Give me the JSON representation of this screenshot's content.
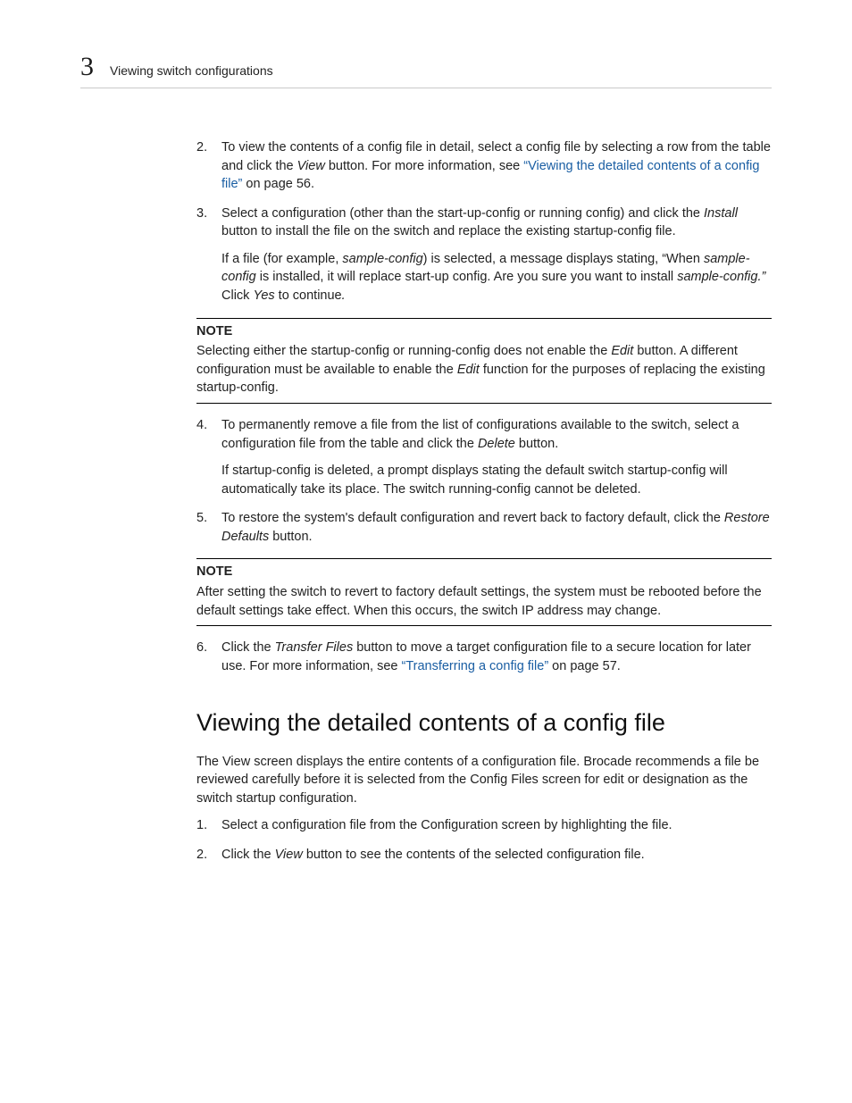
{
  "header": {
    "chapter_number": "3",
    "chapter_title": "Viewing switch configurations"
  },
  "steps_a": [
    {
      "n": "2.",
      "pre": "To view the contents of a config file in detail, select a config file by selecting a row from the table and click the ",
      "i1": "View",
      "mid": " button. For more information, see ",
      "link": "“Viewing the detailed contents of a config file”",
      "post": " on page 56."
    },
    {
      "n": "3.",
      "line1_pre": "Select a configuration (other than the start-up-config or running config) and click the ",
      "line1_i": "Install",
      "line1_post": " button to install the file on the switch and replace the existing startup-config file.",
      "p2_a": "If a file (for example, ",
      "p2_i1": "sample-config",
      "p2_b": ") is selected, a message displays stating, “When ",
      "p2_i2": "sample-config",
      "p2_c": " is installed, it will replace start-up config. Are you sure you want to install ",
      "p2_i3": "sample-config.”",
      "p2_d": " Click ",
      "p2_i4": "Yes",
      "p2_e": " to continue",
      "p2_i5": "."
    }
  ],
  "note1": {
    "label": "NOTE",
    "a": "Selecting either the startup-config or running-config does not enable the ",
    "i1": "Edit",
    "b": " button. A different configuration must be available to enable the ",
    "i2": "Edit",
    "c": " function for the purposes of replacing the existing startup-config."
  },
  "steps_b": [
    {
      "n": "4.",
      "a": "To permanently remove a file from the list of configurations available to the switch, select a configuration file from the table and click the ",
      "i1": "Delete",
      "b": " button.",
      "p2": "If startup-config is deleted, a prompt displays stating the default switch startup-config will automatically take its place. The switch running-config cannot be deleted."
    },
    {
      "n": "5.",
      "a": "To restore the system's default configuration and revert back to factory default, click the ",
      "i1": "Restore Defaults",
      "b": " button."
    }
  ],
  "note2": {
    "label": "NOTE",
    "text": "After setting the switch to revert to factory default settings, the system must be rebooted before the default settings take effect. When this occurs, the switch IP address may change."
  },
  "steps_c": [
    {
      "n": "6.",
      "a": "Click the ",
      "i1": "Transfer Files",
      "b": " button to move a target configuration file to a secure location for later use. For more information, see ",
      "link": "“Transferring a config file”",
      "c": " on page 57."
    }
  ],
  "section": {
    "title": "Viewing the detailed contents of a config file",
    "intro": "The View screen displays the entire contents of a configuration file. Brocade recommends a file be reviewed carefully before it is selected from the Config Files screen for edit or designation as the switch startup configuration.",
    "steps": [
      {
        "n": "1.",
        "text": "Select a configuration file from the Configuration screen by highlighting the file."
      },
      {
        "n": "2.",
        "a": "Click the ",
        "i1": "View",
        "b": " button to see the contents of the selected configuration file."
      }
    ]
  }
}
